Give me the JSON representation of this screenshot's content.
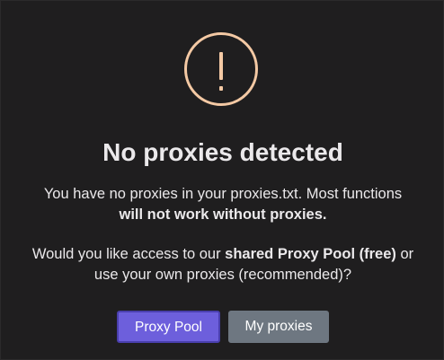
{
  "dialog": {
    "icon": "exclamation-circle-icon",
    "title": "No proxies detected",
    "para1_line1": "You have no proxies in your proxies.txt. Most functions",
    "para1_line2_bold": "will not work without proxies.",
    "para2_prefix": "Would you like access to our ",
    "para2_bold": "shared Proxy Pool (free)",
    "para2_suffix": " or",
    "para2_line2": "use your own proxies (recommended)?",
    "primary_button": "Proxy Pool",
    "secondary_button": "My proxies"
  },
  "colors": {
    "background": "#1f1e1f",
    "warning_accent": "#f4c9a4",
    "primary": "#6d5fdc",
    "secondary": "#6e7781",
    "text": "#ebe9eb"
  }
}
